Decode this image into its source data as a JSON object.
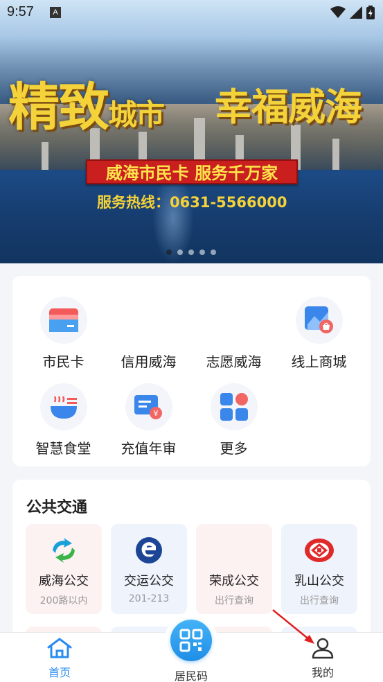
{
  "status_bar": {
    "time": "9:57",
    "notification_badge": "A"
  },
  "banner": {
    "slogan_left_big": "精致",
    "slogan_left_small": "城市",
    "slogan_right": "幸福威海",
    "red_band": "威海市民卡 服务千万家",
    "hotline": "服务热线：0631-5566000",
    "page_count": 5,
    "active_page": 1
  },
  "services": [
    {
      "label": "市民卡",
      "icon": "card-icon"
    },
    {
      "label": "信用威海",
      "icon": "credit-icon"
    },
    {
      "label": "志愿威海",
      "icon": "volunteer-icon"
    },
    {
      "label": "线上商城",
      "icon": "shop-icon"
    },
    {
      "label": "智慧食堂",
      "icon": "canteen-icon"
    },
    {
      "label": "充值年审",
      "icon": "recharge-icon"
    },
    {
      "label": "更多",
      "icon": "more-grid-icon"
    }
  ],
  "transit": {
    "title": "公共交通",
    "items": [
      {
        "name": "威海公交",
        "sub": "200路以内",
        "icon": "weihai-bus-logo-icon"
      },
      {
        "name": "交运公交",
        "sub": "201-213",
        "icon": "jiaoyun-logo-icon"
      },
      {
        "name": "荣成公交",
        "sub": "出行查询",
        "icon": "rongcheng-logo-icon"
      },
      {
        "name": "乳山公交",
        "sub": "出行查询",
        "icon": "rushan-logo-icon"
      }
    ]
  },
  "nav": {
    "home": "首页",
    "qr": "居民码",
    "me": "我的"
  },
  "colors": {
    "accent": "#2a8cf0",
    "banner_yellow": "#f4d23a",
    "banner_red": "#c91f1f",
    "annotation_arrow": "#e02020"
  }
}
